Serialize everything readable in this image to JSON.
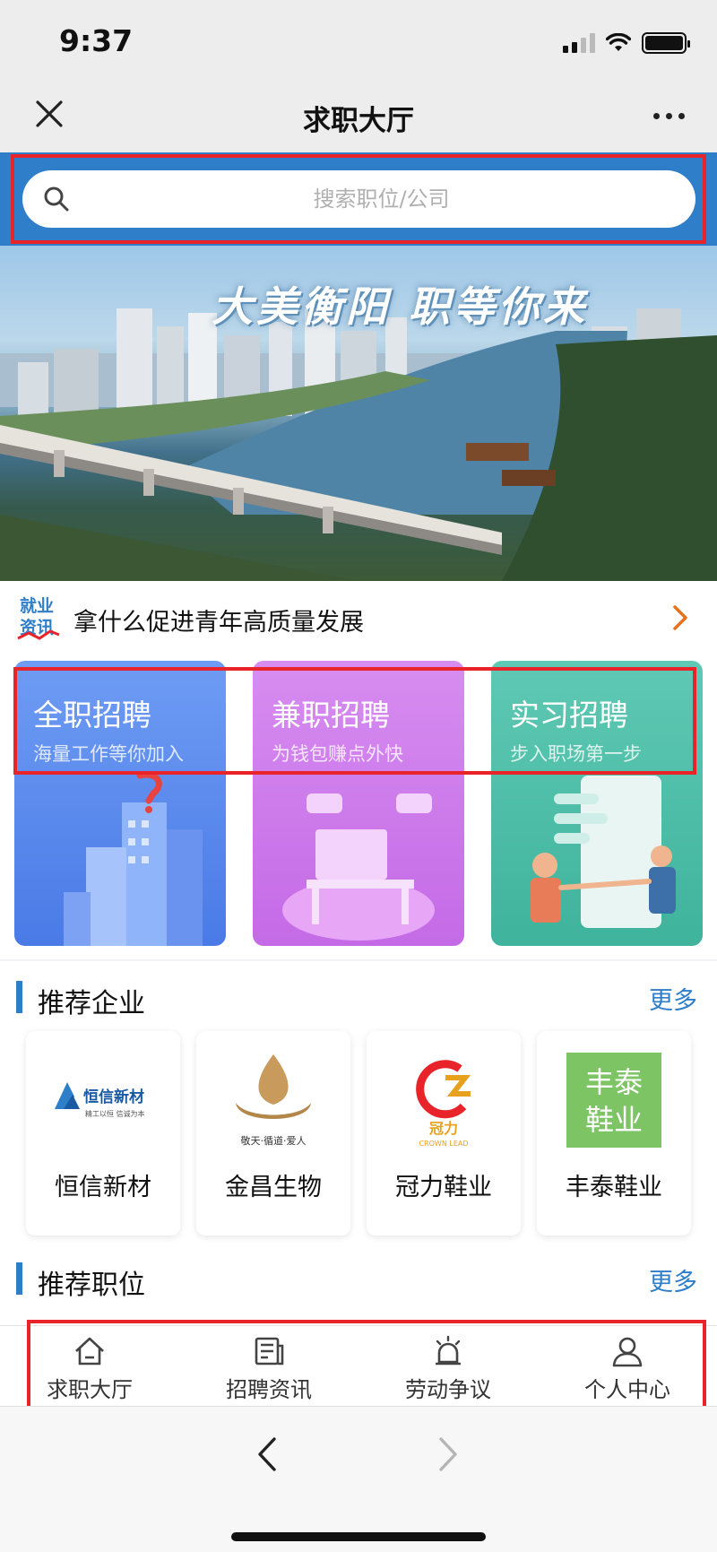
{
  "status": {
    "time": "9:37"
  },
  "nav": {
    "title": "求职大厅"
  },
  "search": {
    "placeholder": "搜索职位/公司"
  },
  "banner": {
    "slogan": "大美衡阳 职等你来"
  },
  "news": {
    "badge_text": "就业资讯",
    "headline": "拿什么促进青年高质量发展"
  },
  "job_cards": [
    {
      "title": "全职招聘",
      "subtitle": "海量工作等你加入"
    },
    {
      "title": "兼职招聘",
      "subtitle": "为钱包赚点外快"
    },
    {
      "title": "实习招聘",
      "subtitle": "步入职场第一步"
    }
  ],
  "companies_section": {
    "title": "推荐企业",
    "more": "更多"
  },
  "companies": [
    {
      "name": "恒信新材",
      "logo_text": "恒信新材",
      "logo_sub": "精工以恒 信诚为本"
    },
    {
      "name": "金昌生物",
      "logo_text": "敬天·循道·爱人"
    },
    {
      "name": "冠力鞋业",
      "logo_text": "冠力",
      "logo_sub": "CROWN LEAD"
    },
    {
      "name": "丰泰鞋业",
      "logo_text": "丰泰鞋业"
    }
  ],
  "positions_section": {
    "title": "推荐职位",
    "more": "更多"
  },
  "tabs": [
    {
      "label": "求职大厅",
      "icon": "home-icon"
    },
    {
      "label": "招聘资讯",
      "icon": "news-icon"
    },
    {
      "label": "劳动争议",
      "icon": "alarm-icon"
    },
    {
      "label": "个人中心",
      "icon": "user-icon"
    }
  ],
  "colors": {
    "brand_blue": "#2f7ec9",
    "highlight_red": "#e8232a",
    "full_time": "#5a88ee",
    "part_time": "#cc7aea",
    "intern": "#4fbea8"
  }
}
